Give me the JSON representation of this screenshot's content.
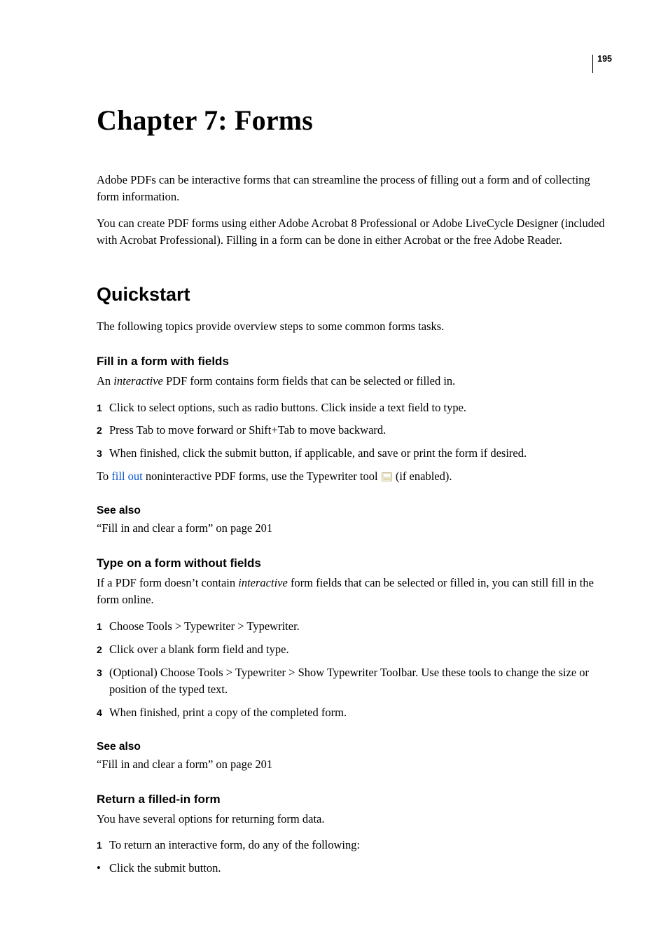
{
  "page_number": "195",
  "chapter_title": "Chapter 7: Forms",
  "intro": {
    "p1": "Adobe PDFs can be interactive forms that can streamline the process of filling out a form and of collecting form information.",
    "p2": "You can create PDF forms using either Adobe Acrobat 8 Professional or Adobe LiveCycle Designer (included with Acrobat Professional). Filling in a form can be done in either Acrobat or the free Adobe Reader."
  },
  "quickstart": {
    "heading": "Quickstart",
    "lead": "The following topics provide overview steps to some common forms tasks."
  },
  "fill_in": {
    "heading": "Fill in a form with fields",
    "lead_pre": "An ",
    "lead_em": "interactive",
    "lead_post": " PDF form contains form fields that can be selected or filled in.",
    "steps": [
      "Click to select options, such as radio buttons. Click inside a text field to type.",
      "Press Tab to move forward or Shift+Tab to move backward.",
      "When finished, click the submit button, if applicable, and save or print the form if desired."
    ],
    "tail_pre": "To ",
    "tail_link": "fill out",
    "tail_mid": " noninteractive PDF forms, use the Typewriter tool ",
    "tail_post": " (if enabled).",
    "see_also_heading": "See also",
    "see_also_text": "“Fill in and clear a form” on page 201"
  },
  "type_on": {
    "heading": "Type on a form without fields",
    "lead_pre": "If a PDF form doesn’t contain ",
    "lead_em": "interactive",
    "lead_post": " form fields that can be selected or filled in, you can still fill in the form online.",
    "steps": [
      "Choose Tools > Typewriter > Typewriter.",
      "Click over a blank form field and type.",
      "(Optional) Choose Tools > Typewriter > Show Typewriter Toolbar. Use these tools to change the size or position of the typed text.",
      "When finished, print a copy of the completed form."
    ],
    "see_also_heading": "See also",
    "see_also_text": "“Fill in and clear a form” on page 201"
  },
  "return_form": {
    "heading": "Return a filled-in form",
    "lead": "You have several options for returning form data.",
    "steps": [
      "To return an interactive form, do any of the following:"
    ],
    "bullets": [
      "Click the submit button."
    ]
  }
}
